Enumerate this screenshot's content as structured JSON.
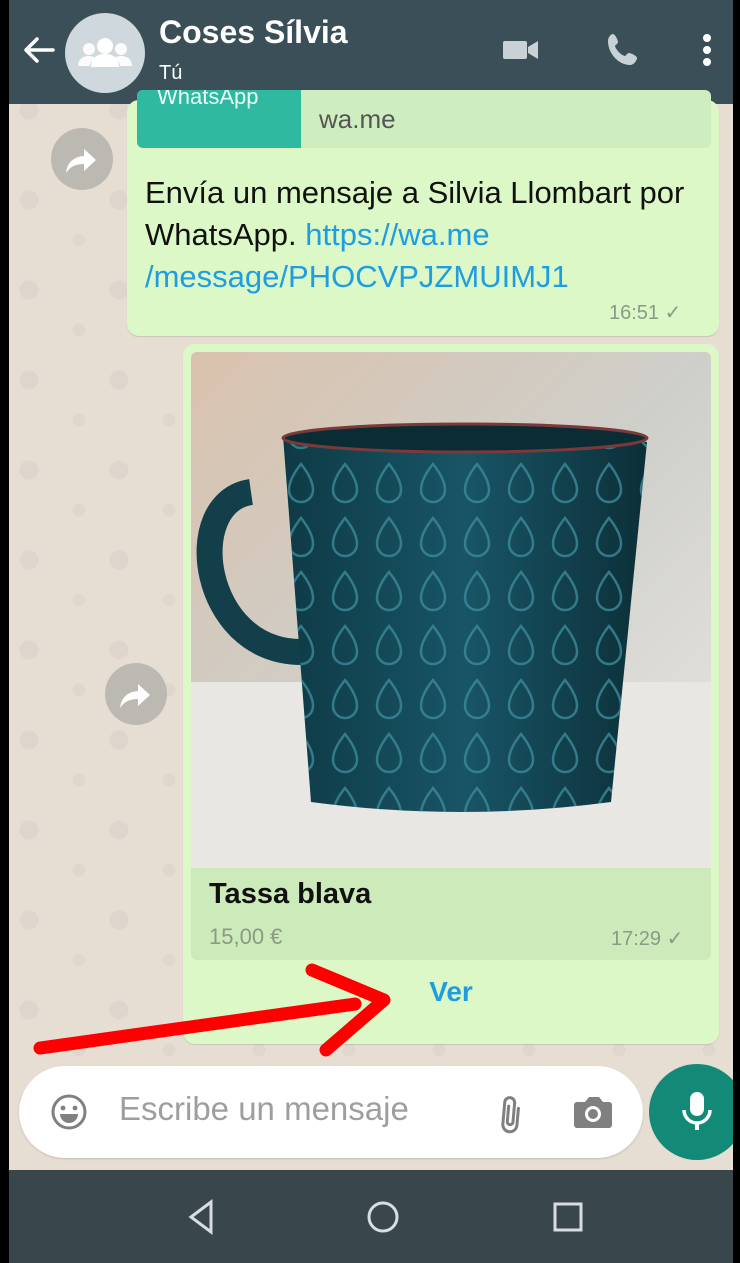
{
  "header": {
    "title": "Coses Sílvia",
    "subtitle": "Tú",
    "icons": [
      "back-arrow-icon",
      "group-avatar-icon",
      "video-call-icon",
      "phone-icon",
      "more-vert-icon"
    ]
  },
  "messages": {
    "link_message": {
      "domain": "wa.me",
      "text_before": "Envía un mensaje a Silvia Llombart por WhatsApp. ",
      "link": "https://wa.me /message/PHOCVPJZMUIMJ1",
      "time": "16:51",
      "status": "✓"
    },
    "product_message": {
      "name": "Tassa blava",
      "price": "15,00 €",
      "time": "17:29",
      "status": "✓",
      "action": "Ver"
    }
  },
  "composer": {
    "placeholder": "Escribe un mensaje",
    "icons": [
      "emoji-icon",
      "attach-icon",
      "camera-icon",
      "mic-icon"
    ]
  },
  "navbar": {
    "icons": [
      "back-triangle-icon",
      "home-circle-icon",
      "recents-square-icon"
    ]
  },
  "annotation": {
    "color": "#ff0000"
  }
}
